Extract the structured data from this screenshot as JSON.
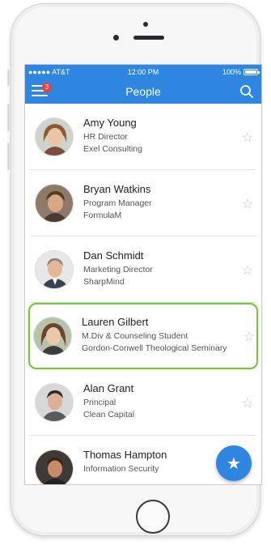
{
  "status_bar": {
    "carrier": "●●●●● AT&T",
    "time": "12:00 PM",
    "battery": "100%"
  },
  "header": {
    "title": "People",
    "menu_badge": "3",
    "menu_icon": "hamburger-menu-icon",
    "search_icon": "search-icon"
  },
  "colors": {
    "accent": "#2e86e0",
    "badge": "#e94040",
    "selection": "#7ec045"
  },
  "people": [
    {
      "name": "Amy Young",
      "title": "HR Director",
      "company": "Exel Consulting"
    },
    {
      "name": "Bryan Watkins",
      "title": "Program Manager",
      "company": "FormulaM"
    },
    {
      "name": "Dan Schmidt",
      "title": "Marketing Director",
      "company": "SharpMind"
    },
    {
      "name": "Lauren Gilbert",
      "title": "M.Div & Counseling Student",
      "company": "Gordon-Conwell Theological Seminary"
    },
    {
      "name": "Alan Grant",
      "title": "Principal",
      "company": "Clean Capital"
    },
    {
      "name": "Thomas Hampton",
      "title": "Information Security",
      "company": ""
    }
  ],
  "fab": {
    "icon": "star-icon"
  }
}
